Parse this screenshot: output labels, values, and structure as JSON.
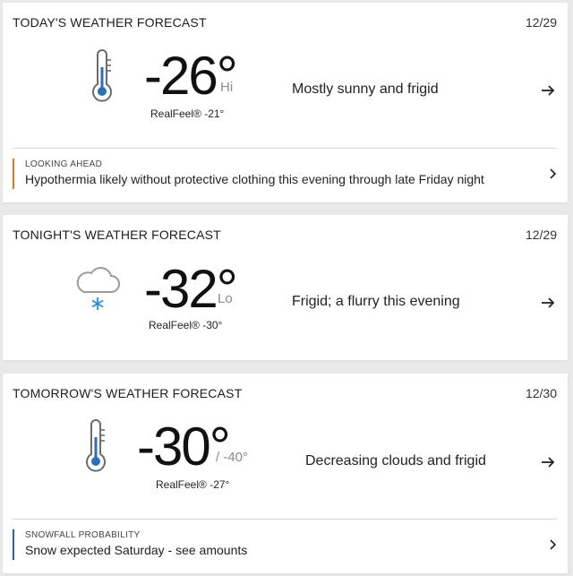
{
  "today": {
    "title": "TODAY'S WEATHER FORECAST",
    "date": "12/29",
    "icon": "thermometer-icon",
    "temp": "-26°",
    "temp_suffix": "Hi",
    "realfeel": "RealFeel® -21°",
    "phrase": "Mostly sunny and frigid",
    "alert": {
      "label": "LOOKING AHEAD",
      "text": "Hypothermia likely without protective clothing this evening through late Friday night",
      "color": "#e0711d"
    }
  },
  "tonight": {
    "title": "TONIGHT'S WEATHER FORECAST",
    "date": "12/29",
    "icon": "cloud-snow-icon",
    "temp": "-32°",
    "temp_suffix": "Lo",
    "realfeel": "RealFeel® -30°",
    "phrase": "Frigid; a flurry this evening"
  },
  "tomorrow": {
    "title": "TOMORROW'S WEATHER FORECAST",
    "date": "12/30",
    "icon": "thermometer-icon",
    "temp": "-30°",
    "temp_suffix": "/ -40°",
    "realfeel": "RealFeel® -27°",
    "phrase": "Decreasing clouds and frigid",
    "alert": {
      "label": "SNOWFALL PROBABILITY",
      "text": "Snow expected Saturday - see amounts",
      "color": "#2f5fb3"
    }
  },
  "colors": {
    "icon_gray": "#6b6b6b",
    "snowflake_blue": "#2a8ae0",
    "card_bg": "#ffffff",
    "page_bg": "#e9e9e9"
  }
}
